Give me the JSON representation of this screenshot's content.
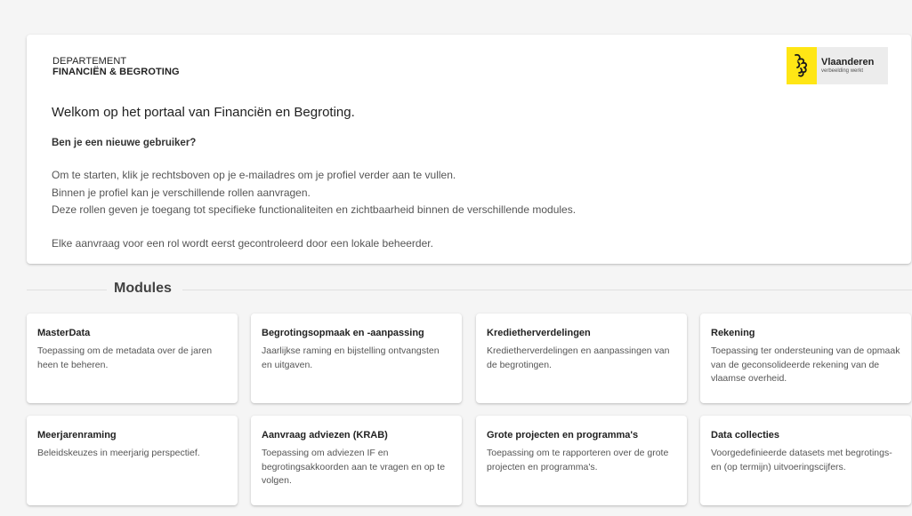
{
  "header": {
    "dept_line1": "DEPARTEMENT",
    "dept_line2": "FINANCIËN & BEGROTING",
    "logo_name": "Vlaanderen",
    "logo_tagline": "verbeelding werkt"
  },
  "welcome": {
    "title": "Welkom op het portaal van Financiën en Begroting.",
    "subtitle": "Ben je een nieuwe gebruiker?",
    "lines": [
      "Om te starten, klik je rechtsboven op je e-mailadres om je profiel verder aan te vullen.",
      "Binnen je profiel kan je verschillende rollen aanvragen.",
      "Deze rollen geven je toegang tot specifieke functionaliteiten en zichtbaarheid binnen de verschillende modules."
    ],
    "note": "Elke aanvraag voor een rol wordt eerst gecontroleerd door een lokale beheerder."
  },
  "modules": {
    "heading": "Modules",
    "items": [
      {
        "title": "MasterData",
        "desc": "Toepassing om de metadata over de jaren heen te beheren."
      },
      {
        "title": "Begrotingsopmaak en -aanpassing",
        "desc": "Jaarlijkse raming en bijstelling ontvangsten en uitgaven."
      },
      {
        "title": "Kredietherverdelingen",
        "desc": "Kredietherverdelingen en aanpassingen van de begrotingen."
      },
      {
        "title": "Rekening",
        "desc": "Toepassing ter ondersteuning van de opmaak van de geconsolideerde rekening van de vlaamse overheid."
      },
      {
        "title": "Meerjarenraming",
        "desc": "Beleidskeuzes in meerjarig perspectief."
      },
      {
        "title": "Aanvraag adviezen (KRAB)",
        "desc": "Toepassing om adviezen IF en begrotingsakkoorden aan te vragen en op te volgen."
      },
      {
        "title": "Grote projecten en programma's",
        "desc": "Toepassing om te rapporteren over de grote projecten en programma's."
      },
      {
        "title": "Data collecties",
        "desc": "Voorgedefinieerde datasets met begrotings- en (op termijn) uitvoeringscijfers."
      }
    ]
  },
  "colors": {
    "page_background": "#f5f5f5",
    "card_background": "#ffffff",
    "flanders_yellow": "#ffe615",
    "logo_background": "#ececec"
  },
  "icons": {
    "logo": "flemish-lion-icon"
  }
}
